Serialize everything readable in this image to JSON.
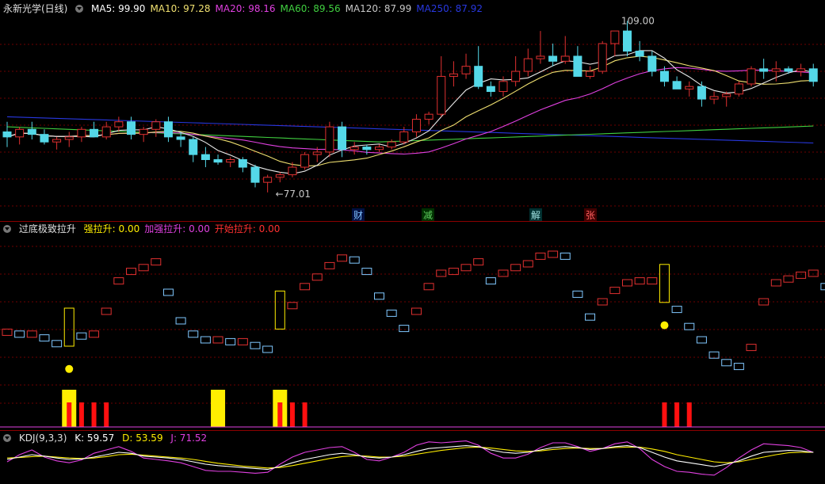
{
  "colors": {
    "bg": "#000000",
    "up": "#e03030",
    "down": "#54d8e8",
    "grid": "#6e0000",
    "ma5": "#e8e8e8",
    "ma10": "#f0e070",
    "ma20": "#e040e0",
    "ma60": "#40d040",
    "ma120": "#c8c8c8",
    "ma250": "#2838e0",
    "yellow": "#ffee00",
    "red": "#ff1010",
    "lightblue": "#80c8ff"
  },
  "header": {
    "stock": "永新光学(日线)",
    "ma": [
      {
        "label": "MA5: 99.90",
        "color": "#ffffff"
      },
      {
        "label": "MA10: 97.28",
        "color": "#f0e070"
      },
      {
        "label": "MA20: 98.16",
        "color": "#e040e0"
      },
      {
        "label": "MA60: 89.56",
        "color": "#40d040"
      },
      {
        "label": "MA120: 87.99",
        "color": "#c8c8c8"
      },
      {
        "label": "MA250: 87.92",
        "color": "#2838e0"
      }
    ]
  },
  "price_annotations": {
    "high": "109.00",
    "low": "77.01"
  },
  "news_tags": [
    "财",
    "减",
    "解",
    "张"
  ],
  "indicator": {
    "title": "过底极致拉升",
    "items": [
      {
        "label": "强拉升: 0.00",
        "color": "#ffee00"
      },
      {
        "label": "加强拉升: 0.00",
        "color": "#e040e0"
      },
      {
        "label": "开始拉升: 0.00",
        "color": "#ff3030"
      }
    ]
  },
  "kdj": {
    "title": "KDJ(9,3,3)",
    "k": "K: 59.57",
    "d": "D: 53.59",
    "j": "J: 71.52"
  },
  "candles": [
    [
      89,
      91,
      86,
      88
    ],
    [
      88,
      90,
      86.5,
      89.5
    ],
    [
      89.5,
      91,
      87.5,
      88.5
    ],
    [
      88.5,
      89.5,
      86.5,
      87
    ],
    [
      87,
      88,
      85.5,
      87.5
    ],
    [
      87.5,
      89,
      86,
      88
    ],
    [
      88,
      90,
      87,
      89.5
    ],
    [
      89.5,
      91,
      88,
      88
    ],
    [
      88,
      91,
      87.5,
      90
    ],
    [
      90,
      92,
      89,
      91
    ],
    [
      91,
      92,
      87.5,
      88.5
    ],
    [
      88.5,
      90,
      87,
      89.5
    ],
    [
      89.5,
      91.5,
      88,
      91
    ],
    [
      91,
      92,
      87,
      88
    ],
    [
      88,
      89,
      86,
      87.5
    ],
    [
      87.5,
      88,
      83,
      84.5
    ],
    [
      84.5,
      86,
      82,
      83.5
    ],
    [
      83.5,
      84.5,
      82.5,
      83
    ],
    [
      83,
      84,
      82,
      83.5
    ],
    [
      83.5,
      84,
      81,
      82
    ],
    [
      82,
      82.5,
      78,
      79
    ],
    [
      79,
      80.5,
      77,
      80
    ],
    [
      80,
      81,
      79,
      80.5
    ],
    [
      80.5,
      83,
      80,
      82
    ],
    [
      82,
      85,
      81.5,
      84.5
    ],
    [
      84.5,
      86,
      83,
      85
    ],
    [
      85,
      91,
      84,
      90
    ],
    [
      90,
      91,
      84,
      85.5
    ],
    [
      85.5,
      87,
      84.5,
      86
    ],
    [
      86,
      86.5,
      84.5,
      85.5
    ],
    [
      85.5,
      86.5,
      85,
      86
    ],
    [
      86,
      87.5,
      85.5,
      87
    ],
    [
      87,
      90,
      86.5,
      89
    ],
    [
      89,
      92.5,
      88,
      91.5
    ],
    [
      91.5,
      93,
      90.5,
      92.5
    ],
    [
      92.5,
      104,
      92,
      100
    ],
    [
      100,
      103,
      98,
      100.5
    ],
    [
      100.5,
      104.5,
      99.5,
      102
    ],
    [
      102,
      106,
      97.5,
      98
    ],
    [
      98,
      99,
      96,
      97
    ],
    [
      97,
      100,
      96,
      99
    ],
    [
      99,
      104,
      98,
      101
    ],
    [
      101,
      105.5,
      100,
      103.5
    ],
    [
      103.5,
      109,
      102.5,
      104
    ],
    [
      104,
      106.5,
      102,
      103
    ],
    [
      103,
      108,
      102.5,
      104
    ],
    [
      104,
      106,
      100,
      100
    ],
    [
      100,
      102,
      99.5,
      101
    ],
    [
      101,
      107,
      100.5,
      106.5
    ],
    [
      106.5,
      109,
      104,
      109
    ],
    [
      109,
      111,
      104,
      105
    ],
    [
      105,
      107,
      103,
      104
    ],
    [
      104,
      105,
      100,
      101
    ],
    [
      101,
      102,
      98,
      99
    ],
    [
      99,
      100,
      97.5,
      97.5
    ],
    [
      97.5,
      99,
      96,
      98
    ],
    [
      98,
      99,
      94,
      95.5
    ],
    [
      95.5,
      97,
      94.5,
      96
    ],
    [
      96,
      97,
      94,
      96.5
    ],
    [
      96.5,
      99,
      96,
      98.5
    ],
    [
      98.5,
      102,
      98,
      101.5
    ],
    [
      101.5,
      103.5,
      99.5,
      101
    ],
    [
      101,
      103,
      99,
      101.5
    ],
    [
      101.5,
      102,
      100.5,
      101
    ],
    [
      101,
      102.5,
      100,
      101.5
    ],
    [
      101.5,
      102.5,
      98,
      99
    ]
  ],
  "kdj_values": {
    "k": [
      45,
      50,
      55,
      52,
      48,
      45,
      46,
      50,
      55,
      60,
      58,
      52,
      50,
      48,
      45,
      40,
      35,
      32,
      30,
      28,
      26,
      24,
      30,
      38,
      45,
      50,
      55,
      58,
      55,
      50,
      48,
      50,
      55,
      62,
      68,
      70,
      72,
      74,
      72,
      65,
      60,
      58,
      60,
      65,
      70,
      72,
      70,
      66,
      68,
      72,
      74,
      70,
      60,
      50,
      42,
      38,
      34,
      30,
      35,
      42,
      52,
      60,
      62,
      64,
      63,
      60
    ],
    "d": [
      48,
      49,
      51,
      52,
      50,
      48,
      47,
      48,
      51,
      55,
      56,
      54,
      52,
      50,
      48,
      45,
      41,
      37,
      34,
      31,
      29,
      27,
      28,
      32,
      37,
      42,
      47,
      51,
      53,
      52,
      50,
      50,
      52,
      56,
      60,
      64,
      67,
      70,
      71,
      69,
      66,
      63,
      62,
      63,
      66,
      68,
      69,
      68,
      68,
      70,
      71,
      71,
      67,
      62,
      55,
      50,
      45,
      40,
      38,
      40,
      45,
      50,
      55,
      59,
      60,
      60
    ],
    "j": [
      40,
      55,
      65,
      50,
      42,
      38,
      44,
      58,
      65,
      72,
      62,
      48,
      45,
      42,
      38,
      30,
      22,
      20,
      20,
      18,
      16,
      18,
      35,
      50,
      60,
      65,
      70,
      72,
      60,
      45,
      42,
      50,
      60,
      75,
      82,
      80,
      82,
      84,
      75,
      58,
      48,
      48,
      56,
      70,
      80,
      80,
      72,
      62,
      68,
      78,
      82,
      68,
      45,
      30,
      20,
      18,
      14,
      12,
      28,
      48,
      65,
      78,
      76,
      74,
      70,
      60
    ]
  },
  "indicator_boxes": {
    "values": [
      44,
      43,
      43,
      41,
      38,
      43,
      42,
      43,
      55,
      71,
      76,
      78,
      81,
      65,
      50,
      43,
      40,
      40,
      39,
      39,
      37,
      35,
      52,
      58,
      68,
      73,
      79,
      83,
      82,
      76,
      63,
      54,
      46,
      55,
      68,
      75,
      76,
      78,
      81,
      71,
      75,
      78,
      80,
      84,
      85,
      84,
      64,
      52,
      60,
      66,
      70,
      71,
      71,
      66,
      56,
      47,
      40,
      32,
      28,
      26,
      36,
      60,
      70,
      72,
      74,
      75,
      68
    ],
    "tall": [
      5,
      22,
      53
    ],
    "smiley": [
      5,
      53
    ]
  },
  "signal_bars": {
    "yellow": [
      5,
      17,
      22
    ],
    "red": [
      5,
      6,
      7,
      8,
      22,
      23,
      24,
      53,
      54,
      55
    ]
  }
}
